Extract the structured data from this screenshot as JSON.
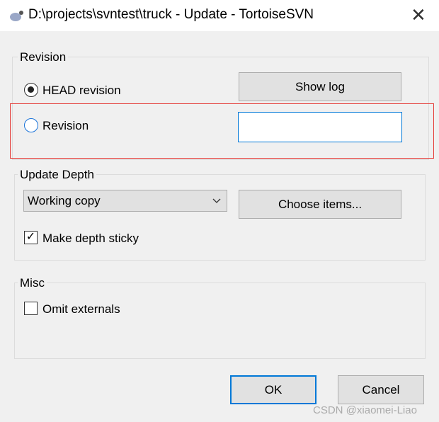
{
  "window": {
    "title": "D:\\projects\\svntest\\truck - Update - TortoiseSVN",
    "close": "✕",
    "icon": "tortoisesvn-icon"
  },
  "revision": {
    "label": "Revision",
    "head_label": "HEAD revision",
    "head_selected": true,
    "revision_label": "Revision",
    "revision_selected": false,
    "revision_value": "",
    "show_log": "Show log",
    "highlight_color": "#e53935"
  },
  "depth": {
    "label": "Update Depth",
    "selected": "Working copy",
    "choose_items": "Choose items...",
    "sticky_label": "Make depth sticky",
    "sticky_checked": true
  },
  "misc": {
    "label": "Misc",
    "omit_label": "Omit externals",
    "omit_checked": false
  },
  "buttons": {
    "ok": "OK",
    "cancel": "Cancel"
  },
  "watermark": "CSDN @xiaomei-Liao"
}
